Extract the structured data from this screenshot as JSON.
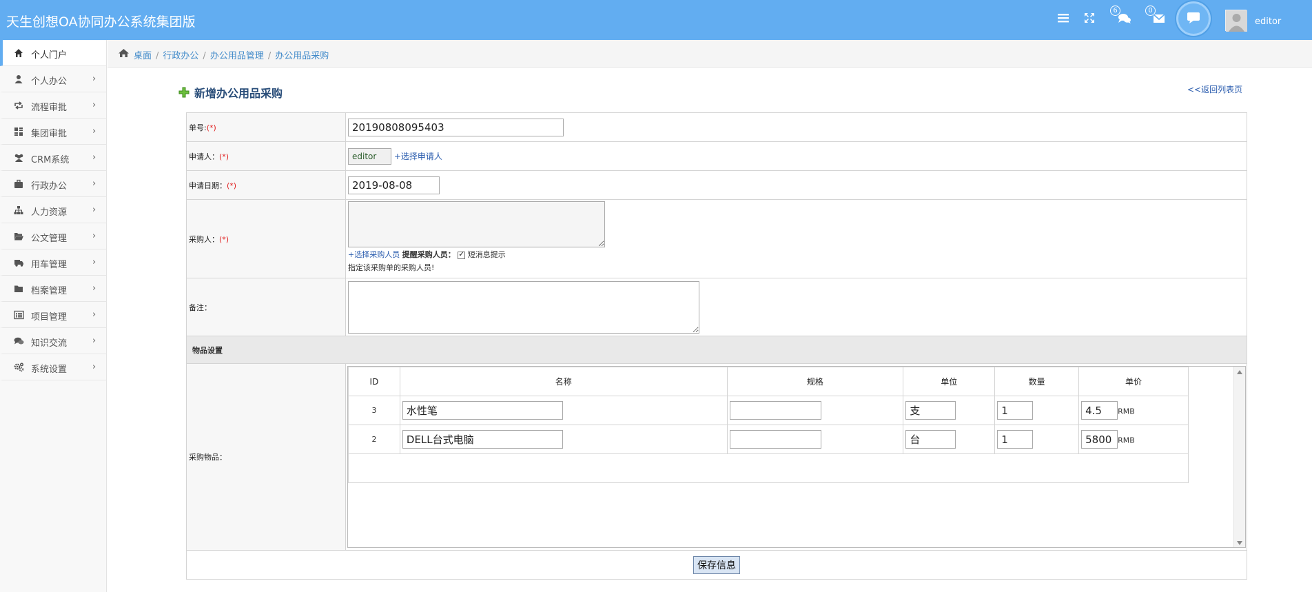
{
  "app": {
    "title": "天生创想OA协同办公系统集团版"
  },
  "topbar": {
    "messages_count": "6",
    "mail_count": "0",
    "username": "editor"
  },
  "sidebar": {
    "items": [
      {
        "label": "个人门户",
        "icon": "home-icon",
        "active": true
      },
      {
        "label": "个人办公",
        "icon": "user-icon"
      },
      {
        "label": "流程审批",
        "icon": "retweet-icon"
      },
      {
        "label": "集团审批",
        "icon": "grid-icon"
      },
      {
        "label": "CRM系统",
        "icon": "users-icon"
      },
      {
        "label": "行政办公",
        "icon": "briefcase-icon"
      },
      {
        "label": "人力资源",
        "icon": "sitemap-icon"
      },
      {
        "label": "公文管理",
        "icon": "folder-open-icon"
      },
      {
        "label": "用车管理",
        "icon": "truck-icon"
      },
      {
        "label": "档案管理",
        "icon": "folder-icon"
      },
      {
        "label": "项目管理",
        "icon": "list-alt-icon"
      },
      {
        "label": "知识交流",
        "icon": "comments-icon"
      },
      {
        "label": "系统设置",
        "icon": "cogs-icon"
      }
    ]
  },
  "breadcrumb": [
    "桌面",
    "行政办公",
    "办公用品管理",
    "办公用品采购"
  ],
  "page": {
    "title": "新增办公用品采购",
    "back_link": "<<返回列表页"
  },
  "form": {
    "number_label": "单号:",
    "number_value": "20190808095403",
    "applicant_label": "申请人：",
    "applicant_value": "editor",
    "select_applicant": "+选择申请人",
    "date_label": "申请日期：",
    "date_value": "2019-08-08",
    "buyer_label": "采购人：",
    "select_buyer": "+选择采购人员",
    "remind_label": "提醒采购人员：",
    "sms_label": "短消息提示",
    "buyer_hint": "指定该采购单的采购人员!",
    "remark_label": "备注：",
    "required_mark": "(*)",
    "section_label": "物品设置",
    "items_label": "采购物品：",
    "save_label": "保存信息"
  },
  "items_table": {
    "headers": [
      "ID",
      "名称",
      "规格",
      "单位",
      "数量",
      "单价"
    ],
    "rows": [
      {
        "id": "3",
        "name": "水性笔",
        "spec": "",
        "unit": "支",
        "qty": "1",
        "price": "4.5",
        "currency": "RMB"
      },
      {
        "id": "2",
        "name": "DELL台式电脑",
        "spec": "",
        "unit": "台",
        "qty": "1",
        "price": "5800",
        "currency": "RMB"
      }
    ]
  },
  "colors": {
    "topbar": "#62adf1",
    "link": "#428bca",
    "required": "#e02020",
    "title": "#2a4e7a"
  }
}
